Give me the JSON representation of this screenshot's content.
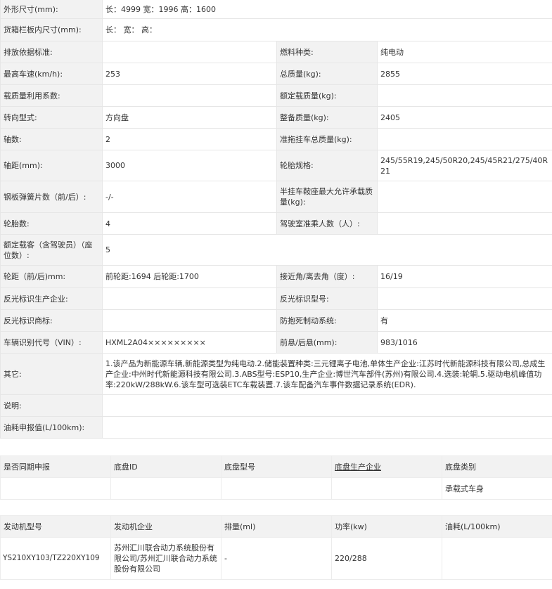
{
  "spec": {
    "dimensions": {
      "label": "外形尺寸(mm):",
      "value": "长：4999 宽：1996 高：1600"
    },
    "cargo_box": {
      "label": "货箱栏板内尺寸(mm):",
      "value": "长： 宽： 高："
    },
    "rows": [
      {
        "l1": "排放依据标准:",
        "v1": "",
        "l2": "燃料种类:",
        "v2": "纯电动"
      },
      {
        "l1": "最高车速(km/h):",
        "v1": "253",
        "l2": "总质量(kg):",
        "v2": "2855"
      },
      {
        "l1": "载质量利用系数:",
        "v1": "",
        "l2": "额定载质量(kg):",
        "v2": ""
      },
      {
        "l1": "转向型式:",
        "v1": "方向盘",
        "l2": "整备质量(kg):",
        "v2": "2405"
      },
      {
        "l1": "轴数:",
        "v1": "2",
        "l2": "准拖挂车总质量(kg):",
        "v2": ""
      },
      {
        "l1": "轴距(mm):",
        "v1": "3000",
        "l2": "轮胎规格:",
        "v2": "245/55R19,245/50R20,245/45R21/275/40R21"
      },
      {
        "l1": "钢板弹簧片数（前/后）:",
        "v1": "-/-",
        "l2": "半挂车鞍座最大允许承载质量(kg):",
        "v2": ""
      },
      {
        "l1": "轮胎数:",
        "v1": "4",
        "l2": "驾驶室准乘人数（人）:",
        "v2": ""
      }
    ],
    "seats": {
      "label": "额定载客（含驾驶员）（座位数）:",
      "value": "5"
    },
    "rows2": [
      {
        "l1": "轮距（前/后)mm:",
        "v1": "前轮距:1694 后轮距:1700",
        "l2": "接近角/离去角（度）:",
        "v2": "16/19"
      },
      {
        "l1": "反光标识生产企业:",
        "v1": "",
        "l2": "反光标识型号:",
        "v2": ""
      },
      {
        "l1": "反光标识商标:",
        "v1": "",
        "l2": "防抱死制动系统:",
        "v2": "有"
      },
      {
        "l1": "车辆识别代号（VIN）:",
        "v1": "HXML2A04×××××××××",
        "l2": "前悬/后悬(mm):",
        "v2": "983/1016"
      }
    ],
    "other": {
      "label": "其它:",
      "value": "1.该产品为新能源车辆,新能源类型为纯电动.2.储能装置种类:三元锂离子电池,单体生产企业:江苏时代新能源科技有限公司,总成生产企业:中州时代新能源科技有限公司.3.ABS型号:ESP10,生产企业:博世汽车部件(苏州)有限公司.4.选装:轮辋.5.驱动电机峰值功率:220kW/288kW.6.该车型可选装ETC车载装置.7.该车配备汽车事件数据记录系统(EDR)."
    },
    "note": {
      "label": "说明:",
      "value": ""
    },
    "fuel": {
      "label": "油耗申报值(L/100km):",
      "value": ""
    }
  },
  "chassis": {
    "headers": [
      "是否同期申报",
      "底盘ID",
      "底盘型号",
      "底盘生产企业",
      "底盘类别"
    ],
    "row": [
      "",
      "",
      "",
      "",
      "承载式车身"
    ]
  },
  "engine": {
    "headers": [
      "发动机型号",
      "发动机企业",
      "排量(ml)",
      "功率(kw)",
      "油耗(L/100km)"
    ],
    "row": [
      "YS210XY103/TZ220XY109",
      "苏州汇川联合动力系统股份有限公司/苏州汇川联合动力系统股份有限公司",
      "-",
      "220/288",
      ""
    ]
  }
}
